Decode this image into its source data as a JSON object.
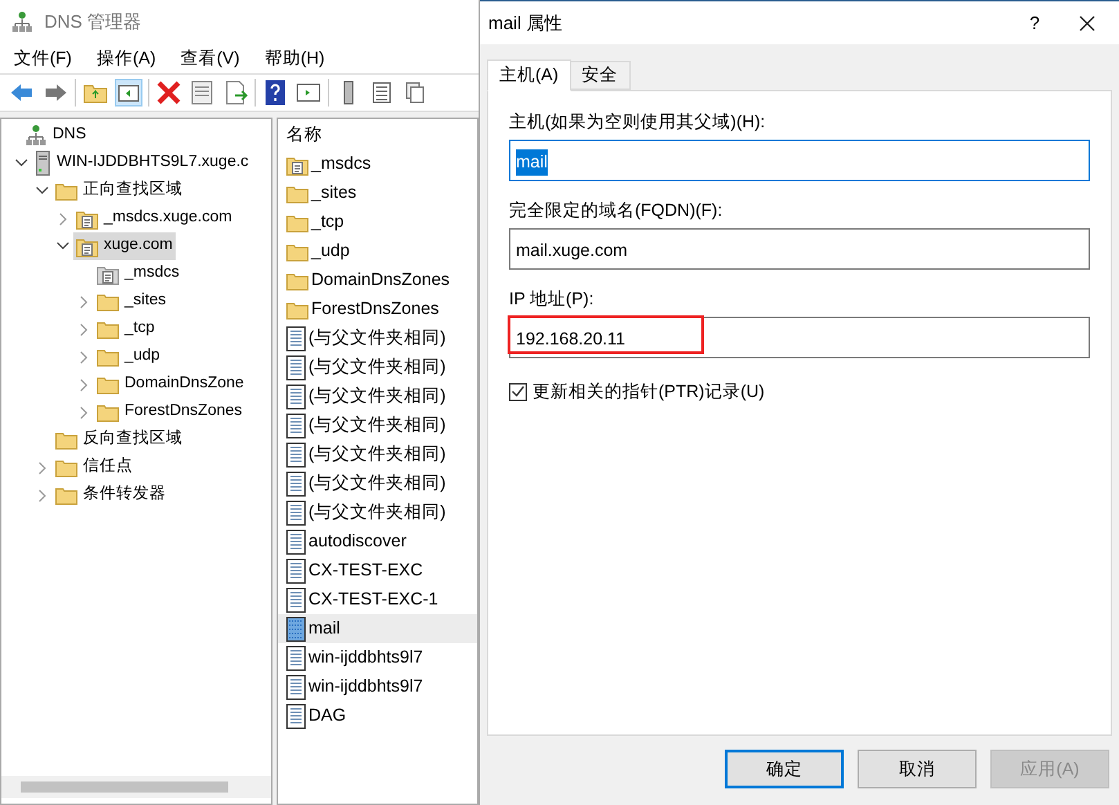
{
  "main_window": {
    "title": "DNS 管理器",
    "menu": [
      "文件(F)",
      "操作(A)",
      "查看(V)",
      "帮助(H)"
    ],
    "tree": [
      {
        "label": "DNS",
        "kind": "dns",
        "selected": false,
        "children": [
          {
            "label": "WIN-IJDDBHTS9L7.xuge.c",
            "kind": "server",
            "expanded": true,
            "selected": false,
            "children": [
              {
                "label": "正向查找区域",
                "kind": "folder",
                "expanded": true,
                "selected": false,
                "children": [
                  {
                    "label": "_msdcs.xuge.com",
                    "kind": "zone",
                    "expanded": false,
                    "selected": false
                  },
                  {
                    "label": "xuge.com",
                    "kind": "zone",
                    "expanded": true,
                    "selected": true,
                    "children": [
                      {
                        "label": "_msdcs",
                        "kind": "zone-grey",
                        "selected": false
                      },
                      {
                        "label": "_sites",
                        "kind": "folder",
                        "expanded": false,
                        "selected": false
                      },
                      {
                        "label": "_tcp",
                        "kind": "folder",
                        "expanded": false,
                        "selected": false
                      },
                      {
                        "label": "_udp",
                        "kind": "folder",
                        "expanded": false,
                        "selected": false
                      },
                      {
                        "label": "DomainDnsZone",
                        "kind": "folder",
                        "expanded": false,
                        "selected": false
                      },
                      {
                        "label": "ForestDnsZones",
                        "kind": "folder",
                        "expanded": false,
                        "selected": false
                      }
                    ]
                  }
                ]
              },
              {
                "label": "反向查找区域",
                "kind": "folder",
                "selected": false
              },
              {
                "label": "信任点",
                "kind": "folder",
                "expanded": false,
                "selected": false
              },
              {
                "label": "条件转发器",
                "kind": "folder",
                "expanded": false,
                "selected": false
              }
            ]
          }
        ]
      }
    ],
    "list": {
      "column": "名称",
      "rows": [
        {
          "name": "_msdcs",
          "kind": "zone",
          "selected": false
        },
        {
          "name": "_sites",
          "kind": "folder",
          "selected": false
        },
        {
          "name": "_tcp",
          "kind": "folder",
          "selected": false
        },
        {
          "name": "_udp",
          "kind": "folder",
          "selected": false
        },
        {
          "name": "DomainDnsZones",
          "kind": "folder",
          "selected": false
        },
        {
          "name": "ForestDnsZones",
          "kind": "folder",
          "selected": false
        },
        {
          "name": "(与父文件夹相同)",
          "kind": "record",
          "selected": false
        },
        {
          "name": "(与父文件夹相同)",
          "kind": "record",
          "selected": false
        },
        {
          "name": "(与父文件夹相同)",
          "kind": "record",
          "selected": false
        },
        {
          "name": "(与父文件夹相同)",
          "kind": "record",
          "selected": false
        },
        {
          "name": "(与父文件夹相同)",
          "kind": "record",
          "selected": false
        },
        {
          "name": "(与父文件夹相同)",
          "kind": "record",
          "selected": false
        },
        {
          "name": "(与父文件夹相同)",
          "kind": "record",
          "selected": false
        },
        {
          "name": "autodiscover",
          "kind": "record",
          "selected": false
        },
        {
          "name": "CX-TEST-EXC",
          "kind": "record",
          "selected": false
        },
        {
          "name": "CX-TEST-EXC-1",
          "kind": "record",
          "selected": false
        },
        {
          "name": "mail",
          "kind": "record-hatched",
          "selected": true
        },
        {
          "name": "win-ijddbhts9l7",
          "kind": "record",
          "selected": false
        },
        {
          "name": "win-ijddbhts9l7",
          "kind": "record",
          "selected": false
        },
        {
          "name": "DAG",
          "kind": "record",
          "selected": false
        }
      ]
    }
  },
  "dialog": {
    "title": "mail 属性",
    "help": "?",
    "tabs": [
      {
        "label": "主机(A)",
        "selected": true
      },
      {
        "label": "安全",
        "selected": false
      }
    ],
    "fields": [
      {
        "label": "主机(如果为空则使用其父域)(H):",
        "value": "mail",
        "focused": true,
        "text_selected": true,
        "highlighted": false
      },
      {
        "label": "完全限定的域名(FQDN)(F):",
        "value": "mail.xuge.com",
        "focused": false,
        "text_selected": false,
        "highlighted": false
      },
      {
        "label": "IP 地址(P):",
        "value": "192.168.20.11",
        "focused": false,
        "text_selected": false,
        "highlighted": true
      }
    ],
    "checkbox": {
      "label": "更新相关的指针(PTR)记录(U)",
      "checked": true
    },
    "buttons": [
      {
        "label": "确定",
        "default": true,
        "disabled": false
      },
      {
        "label": "取消",
        "default": false,
        "disabled": false
      },
      {
        "label": "应用(A)",
        "default": false,
        "disabled": true
      }
    ]
  }
}
